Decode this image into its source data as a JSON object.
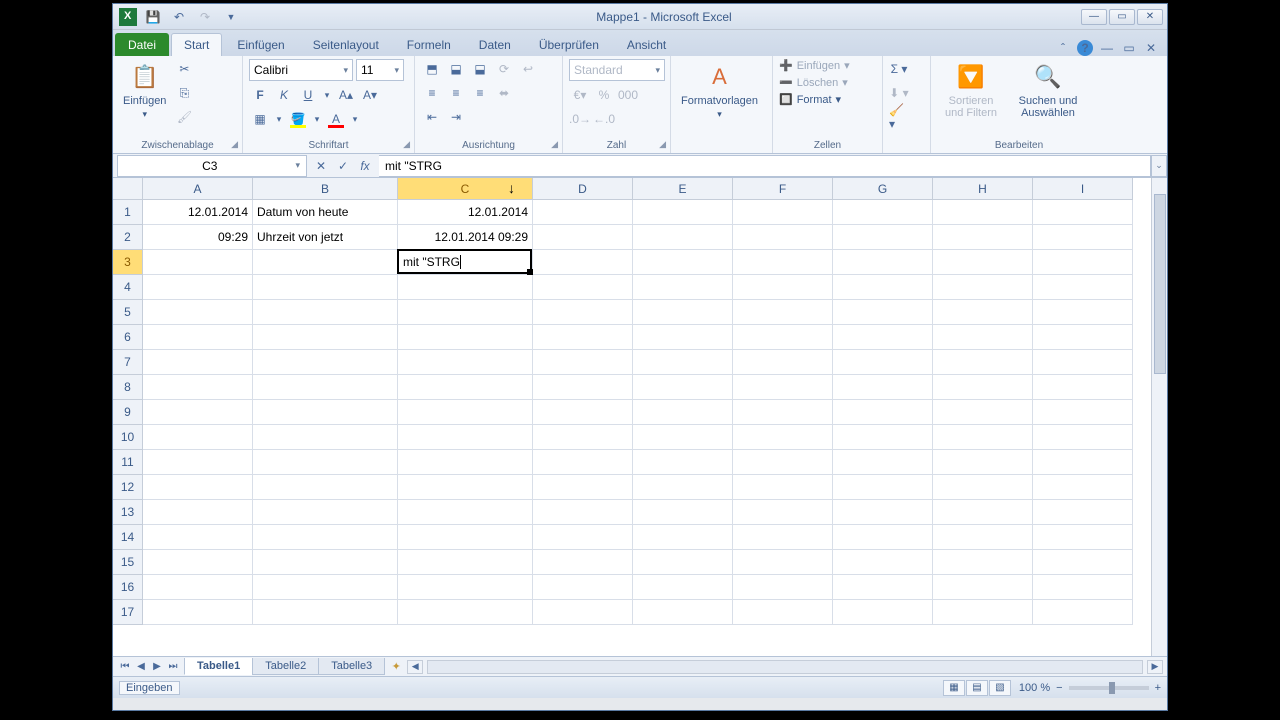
{
  "title": "Mappe1 - Microsoft Excel",
  "tabs": {
    "file": "Datei",
    "start": "Start",
    "einfuegen": "Einfügen",
    "seitenlayout": "Seitenlayout",
    "formeln": "Formeln",
    "daten": "Daten",
    "ueberpruefen": "Überprüfen",
    "ansicht": "Ansicht"
  },
  "ribbon": {
    "clipboard": {
      "paste": "Einfügen",
      "label": "Zwischenablage"
    },
    "font": {
      "name": "Calibri",
      "size": "11",
      "label": "Schriftart"
    },
    "alignment": {
      "label": "Ausrichtung"
    },
    "number": {
      "format": "Standard",
      "label": "Zahl"
    },
    "styles": {
      "formatvorlagen": "Formatvorlagen"
    },
    "cells": {
      "einfuegen": "Einfügen",
      "loeschen": "Löschen",
      "format": "Format",
      "label": "Zellen"
    },
    "editing": {
      "sortfilter": "Sortieren und Filtern",
      "findselect": "Suchen und Auswählen",
      "label": "Bearbeiten"
    }
  },
  "formula": {
    "namebox": "C3",
    "content": "mit \"STRG"
  },
  "columns": [
    "A",
    "B",
    "C",
    "D",
    "E",
    "F",
    "G",
    "H",
    "I"
  ],
  "rows": [
    "1",
    "2",
    "3",
    "4",
    "5",
    "6",
    "7",
    "8",
    "9",
    "10",
    "11",
    "12",
    "13",
    "14",
    "15",
    "16",
    "17"
  ],
  "cells": {
    "A1": "12.01.2014",
    "B1": "Datum von heute",
    "C1": "12.01.2014",
    "A2": "09:29",
    "B2": "Uhrzeit von jetzt",
    "C2": "12.01.2014 09:29",
    "C3": "mit \"STRG"
  },
  "active": {
    "ref": "C3",
    "col": "C",
    "row": "3"
  },
  "sheets": {
    "s1": "Tabelle1",
    "s2": "Tabelle2",
    "s3": "Tabelle3"
  },
  "status": {
    "mode": "Eingeben",
    "zoom": "100 %"
  }
}
